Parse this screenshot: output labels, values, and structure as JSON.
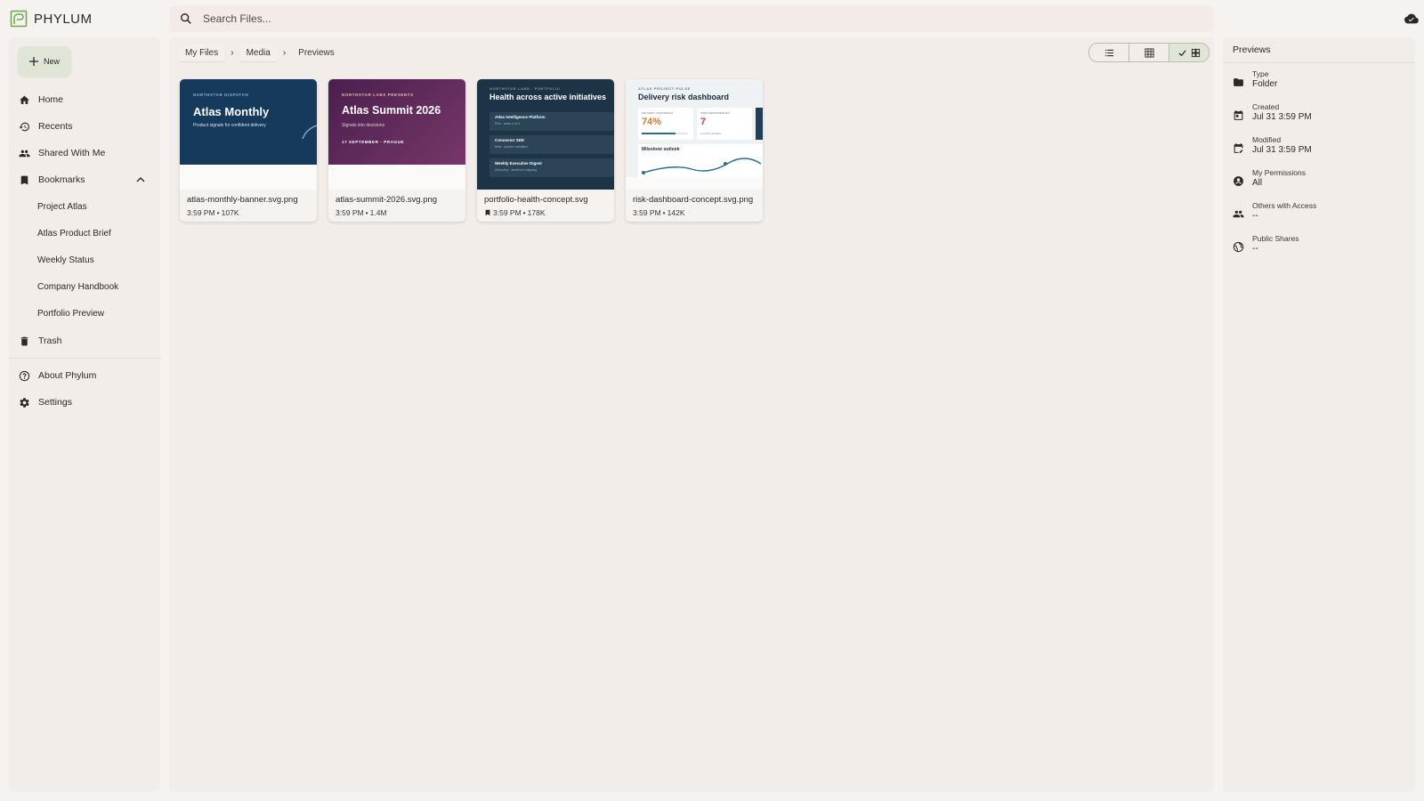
{
  "app": {
    "name": "PHYLUM"
  },
  "search": {
    "placeholder": "Search Files..."
  },
  "sidebar": {
    "new_label": "New",
    "items": [
      {
        "label": "Home",
        "icon": "home-icon"
      },
      {
        "label": "Recents",
        "icon": "history-icon"
      },
      {
        "label": "Shared With Me",
        "icon": "people-icon"
      },
      {
        "label": "Bookmarks",
        "icon": "bookmark-icon"
      }
    ],
    "bookmarks": [
      "Project Atlas",
      "Atlas Product Brief",
      "Weekly Status",
      "Company Handbook",
      "Portfolio Preview"
    ],
    "trash_label": "Trash",
    "about_label": "About Phylum",
    "settings_label": "Settings"
  },
  "breadcrumb": {
    "items": [
      "My Files",
      "Media"
    ],
    "current": "Previews",
    "separator": "›"
  },
  "view": {
    "selected": "gallery",
    "options": [
      "list",
      "grid",
      "gallery"
    ]
  },
  "files": [
    {
      "name": "atlas-monthly-banner.svg.png",
      "time": "3:59 PM",
      "size": "107K",
      "bookmarked": false,
      "thumb": {
        "kicker": "NORTHSTAR DISPATCH",
        "title": "Atlas Monthly",
        "subtitle": "Product signals for confident delivery"
      }
    },
    {
      "name": "atlas-summit-2026.svg.png",
      "time": "3:59 PM",
      "size": "1.4M",
      "bookmarked": false,
      "thumb": {
        "kicker": "NORTHSTAR LABS PRESENTS",
        "title": "Atlas Summit 2026",
        "subtitle": "Signals into decisions",
        "footer": "17 SEPTEMBER · PRAGUE"
      }
    },
    {
      "name": "portfolio-health-concept.svg",
      "time": "3:59 PM",
      "size": "178K",
      "bookmarked": true,
      "thumb": {
        "kicker": "NORTHSTAR LABS · PORTFOLIO",
        "title": "Health across active initiatives",
        "rows": [
          {
            "name": "Atlas Intelligence Platform",
            "sub": "Pilot · week 4 of 6"
          },
          {
            "name": "Connector SDK",
            "sub": "Beta · partner validation"
          },
          {
            "name": "Weekly Executive Digest",
            "sub": "Discovery · audience mapping"
          }
        ]
      }
    },
    {
      "name": "risk-dashboard-concept.svg.png",
      "time": "3:59 PM",
      "size": "142K",
      "bookmarked": false,
      "thumb": {
        "kicker": "ATLAS PROJECT PULSE",
        "title": "Delivery risk dashboard",
        "card1_label": "DELIVERY CONFIDENCE",
        "card1_value": "74%",
        "card2_label": "OPEN DEPENDENCIES",
        "card2_value": "7",
        "card2_sub": "2 need a decision",
        "chart_label": "Milestone outlook"
      }
    }
  ],
  "panel": {
    "title": "Previews",
    "props": [
      {
        "label": "Type",
        "value": "Folder",
        "icon": "folder-icon"
      },
      {
        "label": "Created",
        "value": "Jul 31 3:59 PM",
        "icon": "calendar-icon"
      },
      {
        "label": "Modified",
        "value": "Jul 31 3:59 PM",
        "icon": "calendar-edit-icon"
      },
      {
        "label": "My Permissions",
        "value": "All",
        "icon": "account-circle-icon"
      },
      {
        "label": "Others with Access",
        "value": "--",
        "icon": "group-icon"
      },
      {
        "label": "Public Shares",
        "value": "--",
        "icon": "globe-icon"
      }
    ]
  },
  "colors": {
    "accent": "#dfe6d5",
    "background": "#f6f2ef",
    "panel": "#f2ede9",
    "brand_green": "#6aa84f"
  }
}
